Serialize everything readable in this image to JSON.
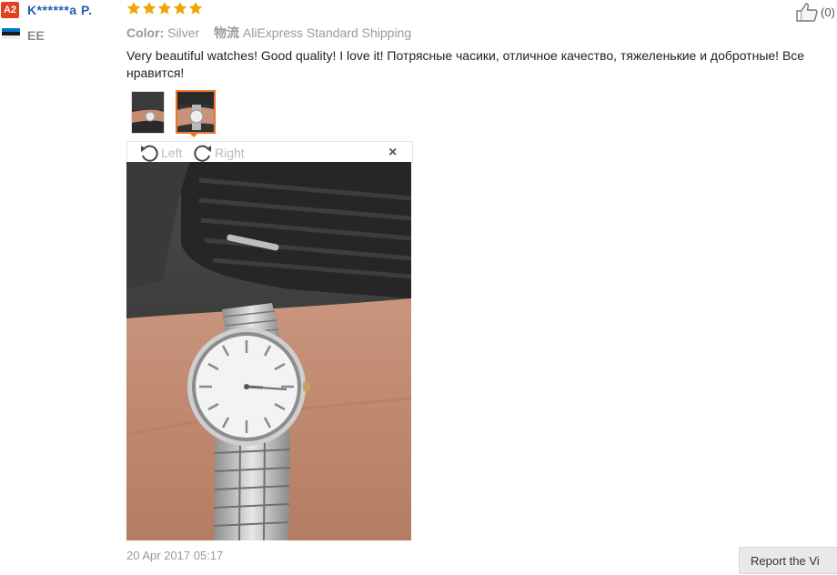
{
  "reviewer": {
    "badge": "A2",
    "name": "K******a P.",
    "country": "EE"
  },
  "rating": {
    "stars": 5,
    "of": 5
  },
  "feedback_meta": {
    "color_label": "Color:",
    "color_value": "Silver",
    "shipping_label": "物流",
    "shipping_value": "AliExpress Standard Shipping"
  },
  "review_text": "Very beautiful watches! Good quality! I love it! Потрясные часики, отличное качество, тяжеленькие и добротные! Все нравится!",
  "helpful": {
    "count_text": "(0)"
  },
  "viewer": {
    "rotate_left_label": "Left",
    "rotate_right_label": "Right",
    "close_glyph": "×"
  },
  "date": "20 Apr 2017 05:17",
  "report_button_label": "Report the Vi",
  "colors": {
    "badge": "#e2401c",
    "username": "#1d5fb6",
    "star": "#f0a500",
    "thumb_selected_border": "#e8772e"
  }
}
